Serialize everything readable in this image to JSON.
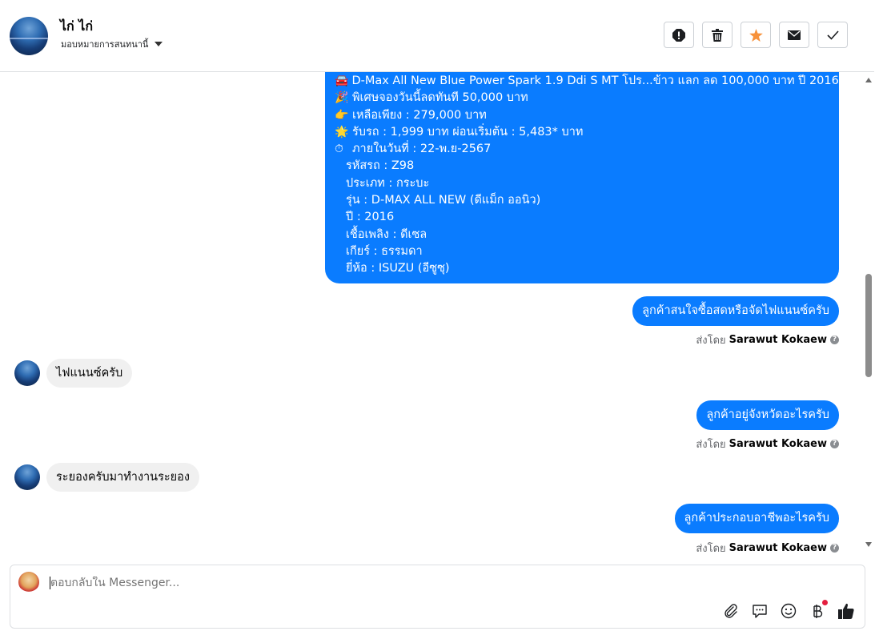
{
  "header": {
    "name": "ไก่ ไก่",
    "assign_label": "มอบหมายการสนทนานี้",
    "actions": [
      "spam-icon",
      "trash-icon",
      "star-icon",
      "mail-icon",
      "check-icon"
    ],
    "star_color": "#f7923b"
  },
  "messages": {
    "car_card": {
      "headline": "D-Max All New Blue Power Spark 1.9 Ddi S MT โปร...ข้าว แลก ลด 100,000 บาท ปี 2016",
      "promo": "พิเศษจองวันนี้ลดทันที 50,000 บาท",
      "price": "เหลือเพียง : 279,000 บาท",
      "down": "รับรถ : 1,999 บาท ผ่อนเริ่มต้น : 5,483* บาท",
      "deadline": "ภายในวันที่ : 22-พ.ย-2567",
      "code": "รหัสรถ : Z98",
      "type": "ประเภท : กระบะ",
      "model": "รุ่น : D-MAX ALL NEW (ดีแม็ก ออนิว)",
      "year": "ปี : 2016",
      "fuel": "เชื้อเพลิง : ดีเซล",
      "gear": "เกียร์ : ธรรมดา",
      "brand": "ยี่ห้อ : ISUZU (อีซูซุ)",
      "emojis": [
        "🚘",
        "🎉",
        "👉",
        "🌟",
        "⏱"
      ]
    },
    "out1": "ลูกค้าสนใจซื้อสดหรือจัดไฟแนนซ์ครับ",
    "in1": "ไฟแนนซ์ครับ",
    "out2": "ลูกค้าอยู่จังหวัดอะไรครับ",
    "in2": "ระยองครับมาทำงานระยอง",
    "out3": "ลูกค้าประกอบอาชีพอะไรครับ",
    "sent_by_prefix": "ส่งโดย",
    "sent_by_name": "Sarawut Kokaew"
  },
  "composer": {
    "placeholder": "ตอบกลับใน Messenger...",
    "tools": [
      "attach-icon",
      "saved-reply-icon",
      "emoji-icon",
      "baht-icon",
      "like-icon"
    ]
  },
  "colors": {
    "bubble_out": "#0a7cff",
    "bubble_in": "#f0f0f0"
  }
}
